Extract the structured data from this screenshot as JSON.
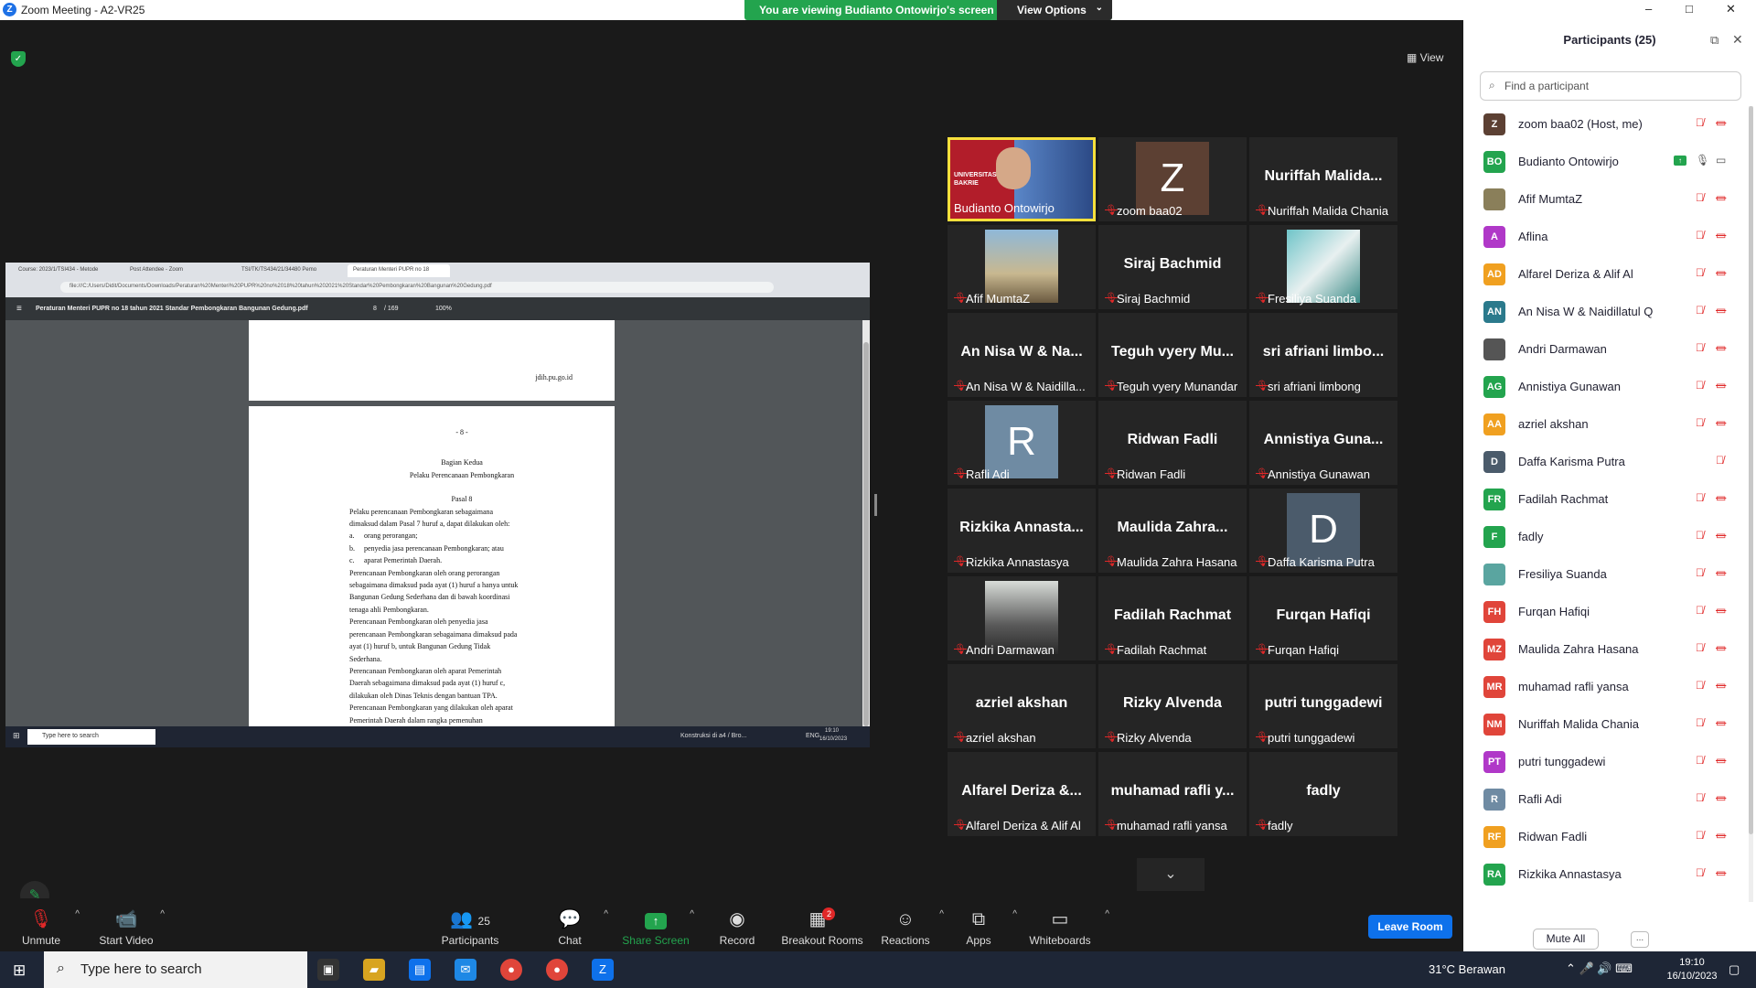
{
  "window": {
    "title": "Zoom Meeting - A2-VR25",
    "logo": "Z",
    "controls": [
      "–",
      "□",
      "✕"
    ]
  },
  "banner": {
    "text": "You are viewing Budianto Ontowirjo's screen",
    "view_options": "View Options"
  },
  "view_button": "View",
  "share": {
    "tabs": [
      "Course: 2023/1/TSI434 - Metode",
      "Post Attendee - Zoom",
      "TSI/TK/TS434/21/34480 Pemo",
      "Peraturan Menteri PUPR no 18"
    ],
    "address": "file:///C:/Users/Didit/Documents/Downloads/Peraturan%20Menteri%20PUPR%20no%2018%20tahun%202021%20Standar%20Pembongkaran%20Bangunan%20Gedung.pdf",
    "pdf_title": "Peraturan Menteri PUPR no 18 tahun 2021 Standar Pembongkaran Bangunan Gedung.pdf",
    "page_num": "8",
    "page_total": "/ 169",
    "zoom": "100%",
    "footer": "jdih.pu.go.id",
    "page_label": "- 8 -",
    "section": "Bagian Kedua",
    "section_title": "Pelaku Perencanaan Pembongkaran",
    "article": "Pasal 8",
    "lines": [
      {
        "n": "(1)",
        "t": "Pelaku perencanaan Pembongkaran sebagaimana"
      },
      {
        "n": "",
        "t": "dimaksud dalam Pasal 7 huruf a, dapat dilakukan oleh:"
      },
      {
        "n": "a.",
        "t": "orang perorangan;",
        "sub": true
      },
      {
        "n": "b.",
        "t": "penyedia jasa perencanaan Pembongkaran; atau",
        "sub": true
      },
      {
        "n": "c.",
        "t": "aparat Pemerintah Daerah.",
        "sub": true
      },
      {
        "n": "(2)",
        "t": "Perencanaan Pembongkaran oleh orang perorangan"
      },
      {
        "n": "",
        "t": "sebagaimana dimaksud pada ayat (1) huruf a hanya untuk"
      },
      {
        "n": "",
        "t": "Bangunan Gedung Sederhana dan di bawah koordinasi"
      },
      {
        "n": "",
        "t": "tenaga ahli Pembongkaran."
      },
      {
        "n": "(3)",
        "t": "Perencanaan Pembongkaran oleh penyedia jasa"
      },
      {
        "n": "",
        "t": "perencanaan Pembongkaran sebagaimana dimaksud pada"
      },
      {
        "n": "",
        "t": "ayat (1) huruf b, untuk Bangunan Gedung Tidak"
      },
      {
        "n": "",
        "t": "Sederhana."
      },
      {
        "n": "(4)",
        "t": "Perencanaan Pembongkaran oleh aparat Pemerintah"
      },
      {
        "n": "",
        "t": "Daerah sebagaimana dimaksud pada ayat (1) huruf c,"
      },
      {
        "n": "",
        "t": "dilakukan oleh Dinas Teknis dengan bantuan TPA."
      },
      {
        "n": "(5)",
        "t": "Perencanaan Pembongkaran yang dilakukan oleh aparat"
      },
      {
        "n": "",
        "t": "Pemerintah Daerah dalam rangka pemenuhan"
      }
    ],
    "taskbar_search": "Type here to search",
    "taskbar_item": "Konstruksi di a4 / Bro...",
    "taskbar_lang": "ENG",
    "taskbar_time": "19:10",
    "taskbar_date": "16/10/2023"
  },
  "gallery": [
    {
      "name": "Budianto Ontowirjo",
      "kind": "video",
      "speaking": true,
      "muted": false,
      "overlay": "UNIVERSITAS BAKRIE"
    },
    {
      "name": "zoom baa02",
      "kind": "avatar",
      "letter": "Z",
      "bg": "#5c4033",
      "muted": true
    },
    {
      "name": "Nuriffah Malida Chania",
      "kind": "text",
      "big": "Nuriffah Malida...",
      "muted": true
    },
    {
      "name": "Afif MumtaZ",
      "kind": "photo",
      "muted": true
    },
    {
      "name": "Siraj Bachmid",
      "kind": "text",
      "big": "Siraj Bachmid",
      "muted": true
    },
    {
      "name": "Fresiliya Suanda",
      "kind": "photo2",
      "muted": true
    },
    {
      "name": "An Nisa W & Naidilla...",
      "kind": "text",
      "big": "An Nisa W & Na...",
      "muted": true
    },
    {
      "name": "Teguh vyery Munandar",
      "kind": "text",
      "big": "Teguh vyery Mu...",
      "muted": true
    },
    {
      "name": "sri afriani limbong",
      "kind": "text",
      "big": "sri afriani limbo...",
      "muted": true
    },
    {
      "name": "Rafli Adi",
      "kind": "avatar",
      "letter": "R",
      "bg": "#6f8ba3",
      "muted": true
    },
    {
      "name": "Ridwan Fadli",
      "kind": "text",
      "big": "Ridwan Fadli",
      "muted": true
    },
    {
      "name": "Annistiya Gunawan",
      "kind": "text",
      "big": "Annistiya Guna...",
      "muted": true
    },
    {
      "name": "Rizkika Annastasya",
      "kind": "text",
      "big": "Rizkika Annasta...",
      "muted": true
    },
    {
      "name": "Maulida Zahra Hasana",
      "kind": "text",
      "big": "Maulida Zahra...",
      "muted": true
    },
    {
      "name": "Daffa Karisma Putra",
      "kind": "avatar",
      "letter": "D",
      "bg": "#4b5b6b",
      "muted": true
    },
    {
      "name": "Andri Darmawan",
      "kind": "photo3",
      "muted": true
    },
    {
      "name": "Fadilah Rachmat",
      "kind": "text",
      "big": "Fadilah Rachmat",
      "muted": true
    },
    {
      "name": "Furqan Hafiqi",
      "kind": "text",
      "big": "Furqan Hafiqi",
      "muted": true
    },
    {
      "name": "azriel akshan",
      "kind": "text",
      "big": "azriel akshan",
      "muted": true
    },
    {
      "name": "Rizky Alvenda",
      "kind": "text",
      "big": "Rizky Alvenda",
      "muted": true
    },
    {
      "name": "putri tunggadewi",
      "kind": "text",
      "big": "putri tunggadewi",
      "muted": true
    },
    {
      "name": "Alfarel Deriza & Alif Al",
      "kind": "text",
      "big": "Alfarel Deriza &...",
      "muted": true
    },
    {
      "name": "muhamad rafli yansa",
      "kind": "text",
      "big": "muhamad rafli y...",
      "muted": true
    },
    {
      "name": "fadly",
      "kind": "text",
      "big": "fadly",
      "muted": true
    }
  ],
  "toolbar": {
    "unmute": "Unmute",
    "start_video": "Start Video",
    "participants": "Participants",
    "participants_count": "25",
    "chat": "Chat",
    "share_screen": "Share Screen",
    "record": "Record",
    "breakout": "Breakout Rooms",
    "breakout_badge": "2",
    "reactions": "Reactions",
    "apps": "Apps",
    "whiteboards": "Whiteboards",
    "leave": "Leave Room"
  },
  "panel": {
    "title": "Participants (25)",
    "find_placeholder": "Find a participant",
    "mute_all": "Mute All",
    "more": "...",
    "participants": [
      {
        "initials": "Z",
        "name": "zoom baa02 (Host, me)",
        "color": "#5c4033",
        "mic": "muted",
        "video": "off"
      },
      {
        "initials": "BO",
        "name": "Budianto Ontowirjo",
        "color": "#23a44e",
        "mic": "on",
        "video": "on",
        "sharing": true
      },
      {
        "initials": "",
        "name": "Afif MumtaZ",
        "color": "#8a7f5a",
        "mic": "muted",
        "video": "off"
      },
      {
        "initials": "A",
        "name": "Aflina",
        "color": "#b038c8",
        "mic": "muted",
        "video": "off"
      },
      {
        "initials": "AD",
        "name": "Alfarel Deriza & Alif Al",
        "color": "#f0a020",
        "mic": "muted",
        "video": "off"
      },
      {
        "initials": "AN",
        "name": "An Nisa W & Naidillatul Q",
        "color": "#2b7a8c",
        "mic": "muted",
        "video": "off"
      },
      {
        "initials": "",
        "name": "Andri Darmawan",
        "color": "#555555",
        "mic": "muted",
        "video": "off"
      },
      {
        "initials": "AG",
        "name": "Annistiya Gunawan",
        "color": "#23a44e",
        "mic": "muted",
        "video": "off"
      },
      {
        "initials": "AA",
        "name": "azriel akshan",
        "color": "#f0a020",
        "mic": "muted",
        "video": "off"
      },
      {
        "initials": "D",
        "name": "Daffa Karisma Putra",
        "color": "#4b5b6b",
        "mic": "muted",
        "video": "none"
      },
      {
        "initials": "FR",
        "name": "Fadilah Rachmat",
        "color": "#23a44e",
        "mic": "muted",
        "video": "off"
      },
      {
        "initials": "F",
        "name": "fadly",
        "color": "#23a44e",
        "mic": "muted",
        "video": "off"
      },
      {
        "initials": "",
        "name": "Fresiliya Suanda",
        "color": "#5aa5a0",
        "mic": "muted",
        "video": "off"
      },
      {
        "initials": "FH",
        "name": "Furqan Hafiqi",
        "color": "#e0453a",
        "mic": "muted",
        "video": "off"
      },
      {
        "initials": "MZ",
        "name": "Maulida Zahra Hasana",
        "color": "#e0453a",
        "mic": "muted",
        "video": "off"
      },
      {
        "initials": "MR",
        "name": "muhamad rafli yansa",
        "color": "#e0453a",
        "mic": "muted",
        "video": "off"
      },
      {
        "initials": "NM",
        "name": "Nuriffah Malida Chania",
        "color": "#e0453a",
        "mic": "muted",
        "video": "off"
      },
      {
        "initials": "PT",
        "name": "putri tunggadewi",
        "color": "#b038c8",
        "mic": "muted",
        "video": "off"
      },
      {
        "initials": "R",
        "name": "Rafli Adi",
        "color": "#6f8ba3",
        "mic": "muted",
        "video": "off"
      },
      {
        "initials": "RF",
        "name": "Ridwan Fadli",
        "color": "#f0a020",
        "mic": "muted",
        "video": "off"
      },
      {
        "initials": "RA",
        "name": "Rizkika Annastasya",
        "color": "#23a44e",
        "mic": "muted",
        "video": "off"
      }
    ]
  },
  "taskbar": {
    "search": "Type here to search",
    "weather": "31°C  Berawan",
    "time": "19:10",
    "date": "16/10/2023"
  }
}
